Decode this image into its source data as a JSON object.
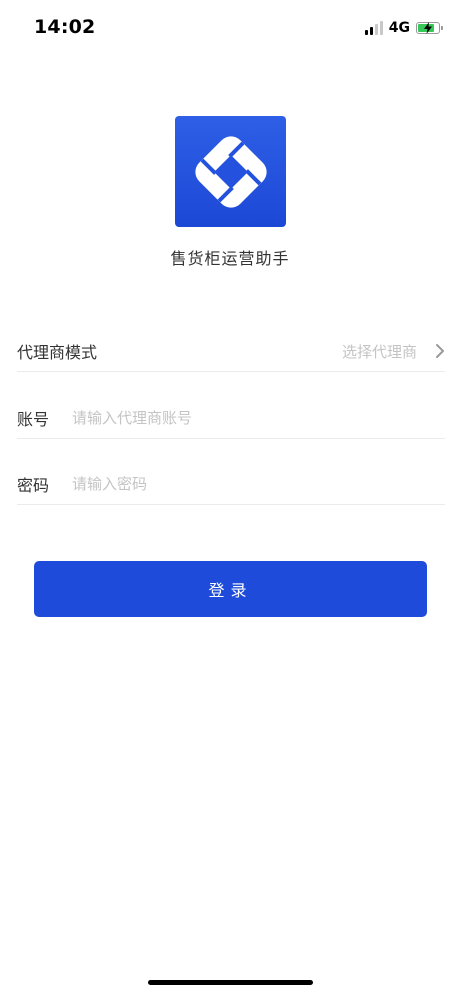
{
  "status_bar": {
    "time": "14:02",
    "network": "4G",
    "battery_color": "#38c759"
  },
  "app": {
    "name": "售货柜运营助手",
    "logo_icon": "app-logo-icon",
    "brand_color": "#1e4bd9"
  },
  "form": {
    "mode": {
      "label": "代理商模式",
      "placeholder": "选择代理商",
      "icon": "chevron-right-icon"
    },
    "account": {
      "label": "账号",
      "placeholder": "请输入代理商账号"
    },
    "password": {
      "label": "密码",
      "placeholder": "请输入密码"
    }
  },
  "login_button": {
    "label": "登录"
  }
}
